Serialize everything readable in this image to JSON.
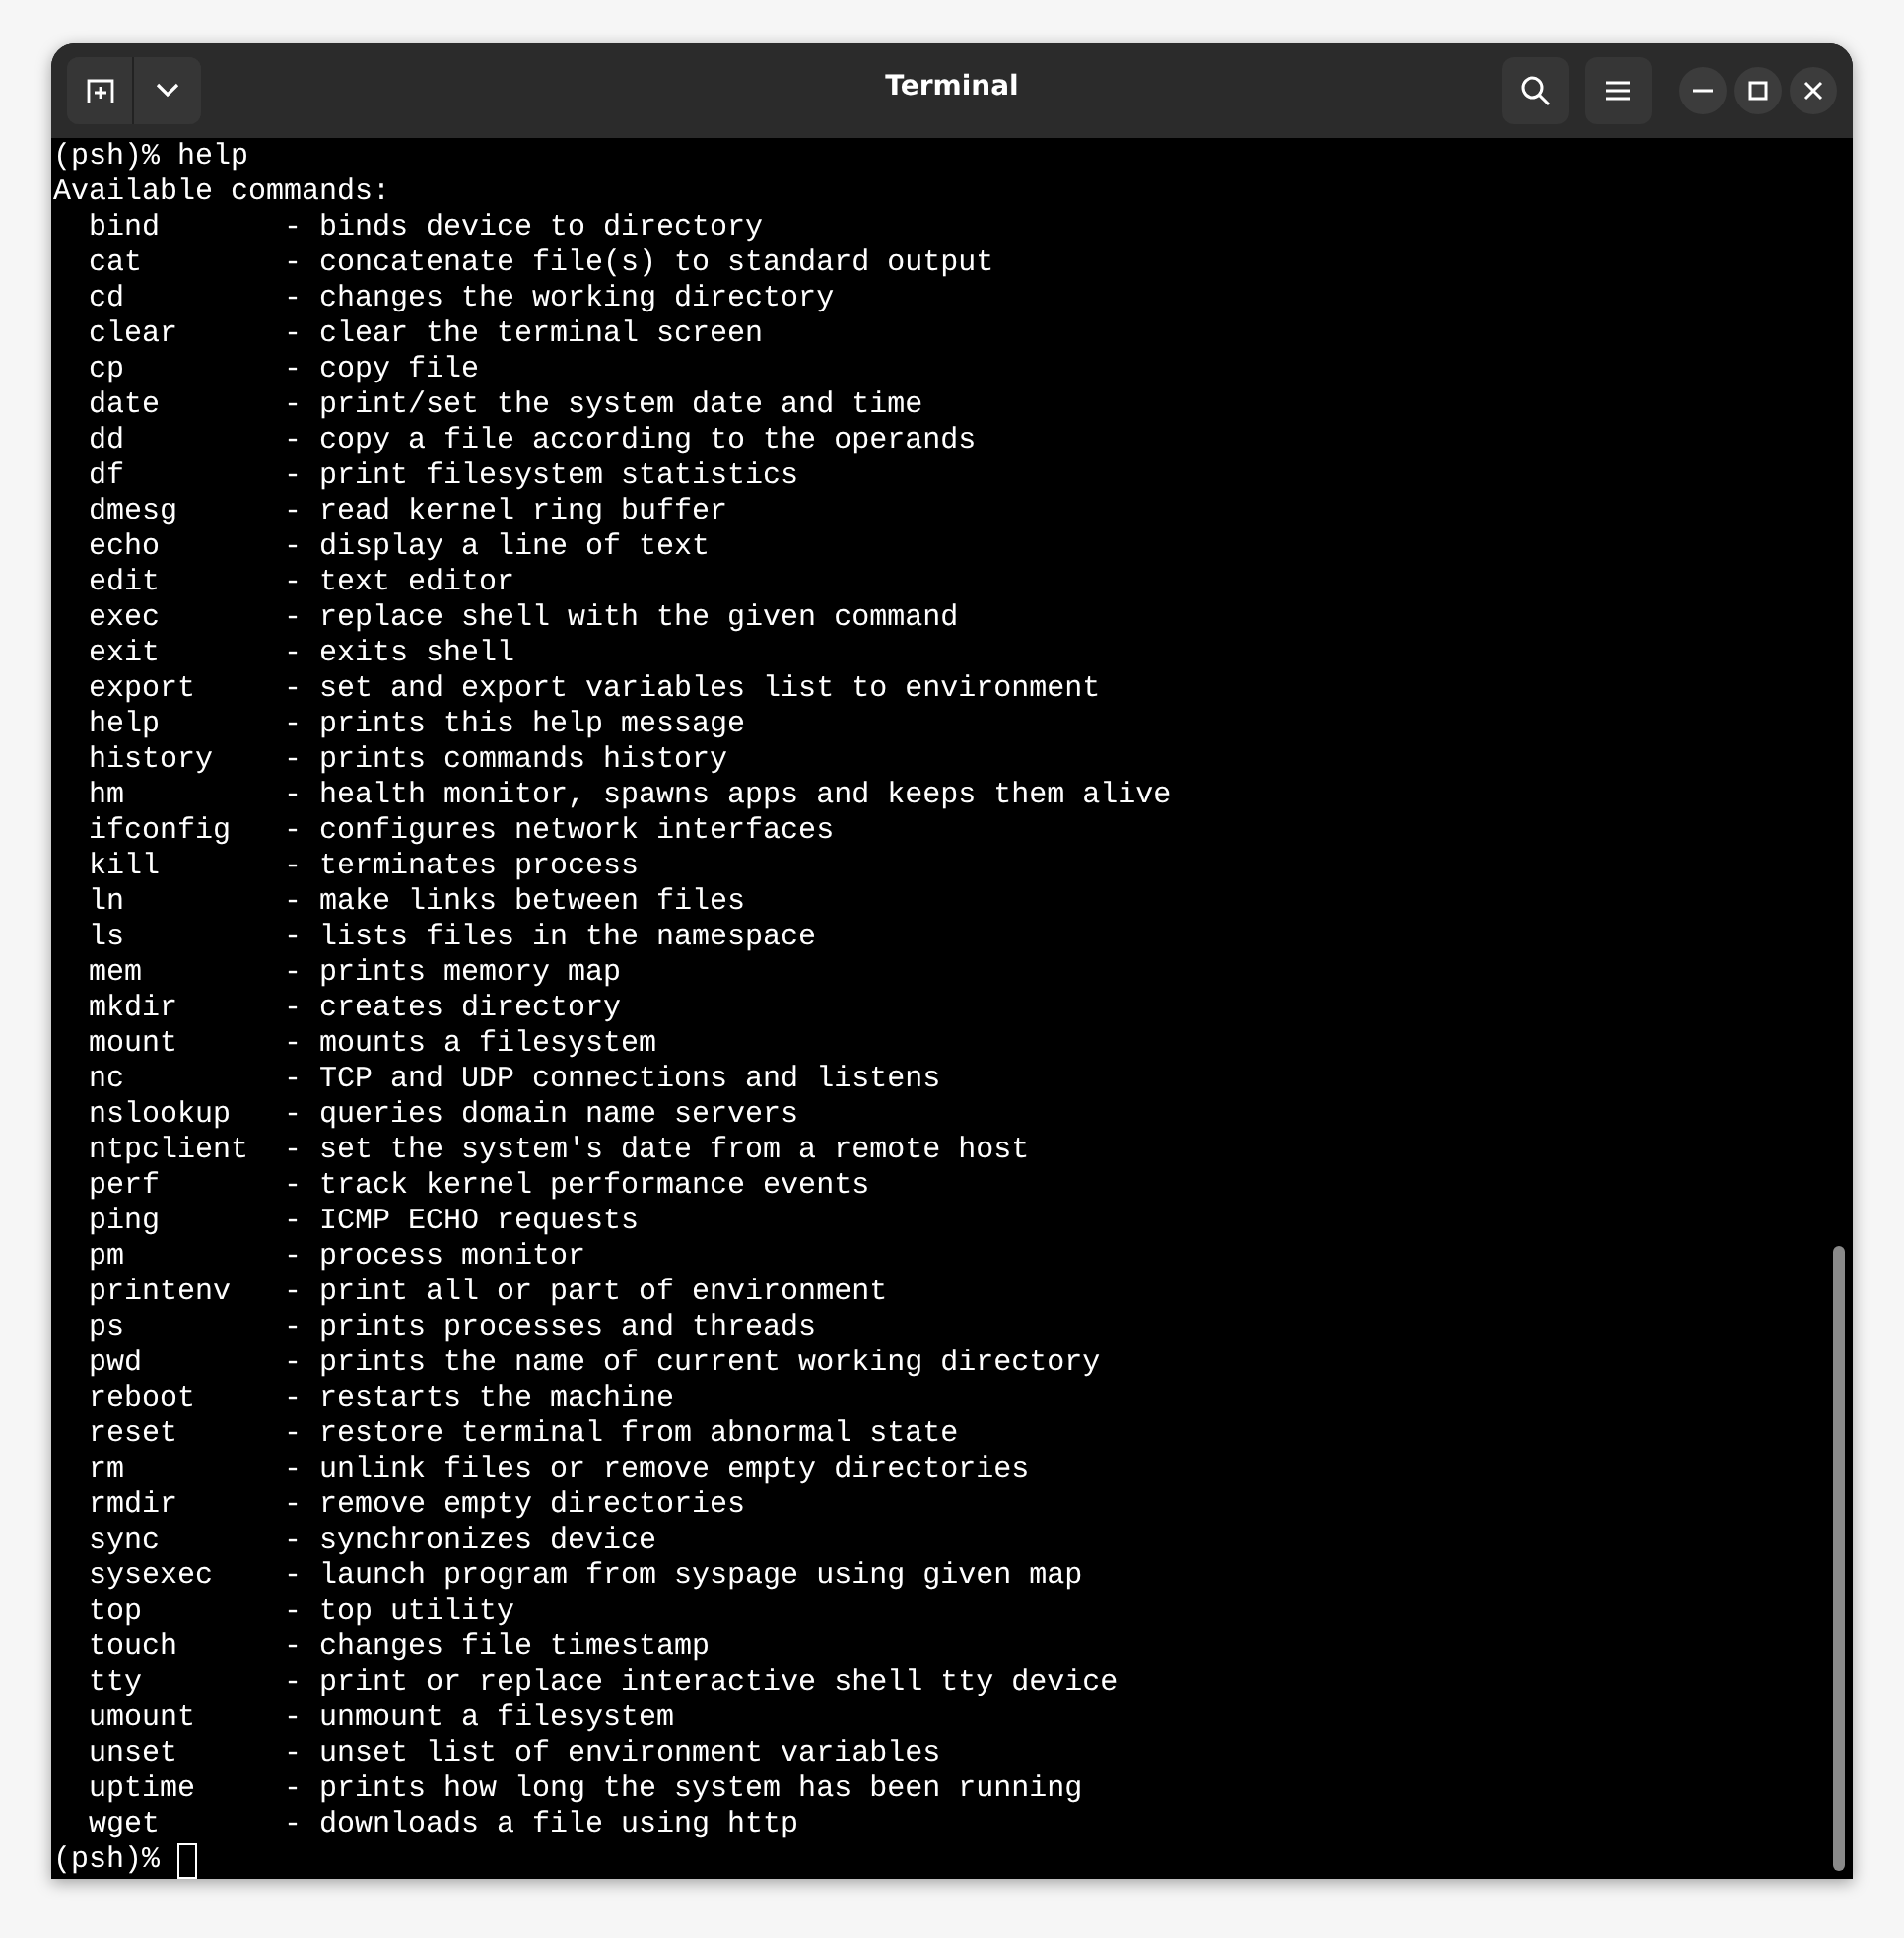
{
  "window": {
    "title": "Terminal"
  },
  "terminal": {
    "lines": [
      "(psh)% help",
      "Available commands:",
      "  bind       - binds device to directory",
      "  cat        - concatenate file(s) to standard output",
      "  cd         - changes the working directory",
      "  clear      - clear the terminal screen",
      "  cp         - copy file",
      "  date       - print/set the system date and time",
      "  dd         - copy a file according to the operands",
      "  df         - print filesystem statistics",
      "  dmesg      - read kernel ring buffer",
      "  echo       - display a line of text",
      "  edit       - text editor",
      "  exec       - replace shell with the given command",
      "  exit       - exits shell",
      "  export     - set and export variables list to environment",
      "  help       - prints this help message",
      "  history    - prints commands history",
      "  hm         - health monitor, spawns apps and keeps them alive",
      "  ifconfig   - configures network interfaces",
      "  kill       - terminates process",
      "  ln         - make links between files",
      "  ls         - lists files in the namespace",
      "  mem        - prints memory map",
      "  mkdir      - creates directory",
      "  mount      - mounts a filesystem",
      "  nc         - TCP and UDP connections and listens",
      "  nslookup   - queries domain name servers",
      "  ntpclient  - set the system's date from a remote host",
      "  perf       - track kernel performance events",
      "  ping       - ICMP ECHO requests",
      "  pm         - process monitor",
      "  printenv   - print all or part of environment",
      "  ps         - prints processes and threads",
      "  pwd        - prints the name of current working directory",
      "  reboot     - restarts the machine",
      "  reset      - restore terminal from abnormal state",
      "  rm         - unlink files or remove empty directories",
      "  rmdir      - remove empty directories",
      "  sync       - synchronizes device",
      "  sysexec    - launch program from syspage using given map",
      "  top        - top utility",
      "  touch      - changes file timestamp",
      "  tty        - print or replace interactive shell tty device",
      "  umount     - unmount a filesystem",
      "  unset      - unset list of environment variables",
      "  uptime     - prints how long the system has been running",
      "  wget       - downloads a file using http"
    ],
    "prompt": "(psh)%"
  }
}
